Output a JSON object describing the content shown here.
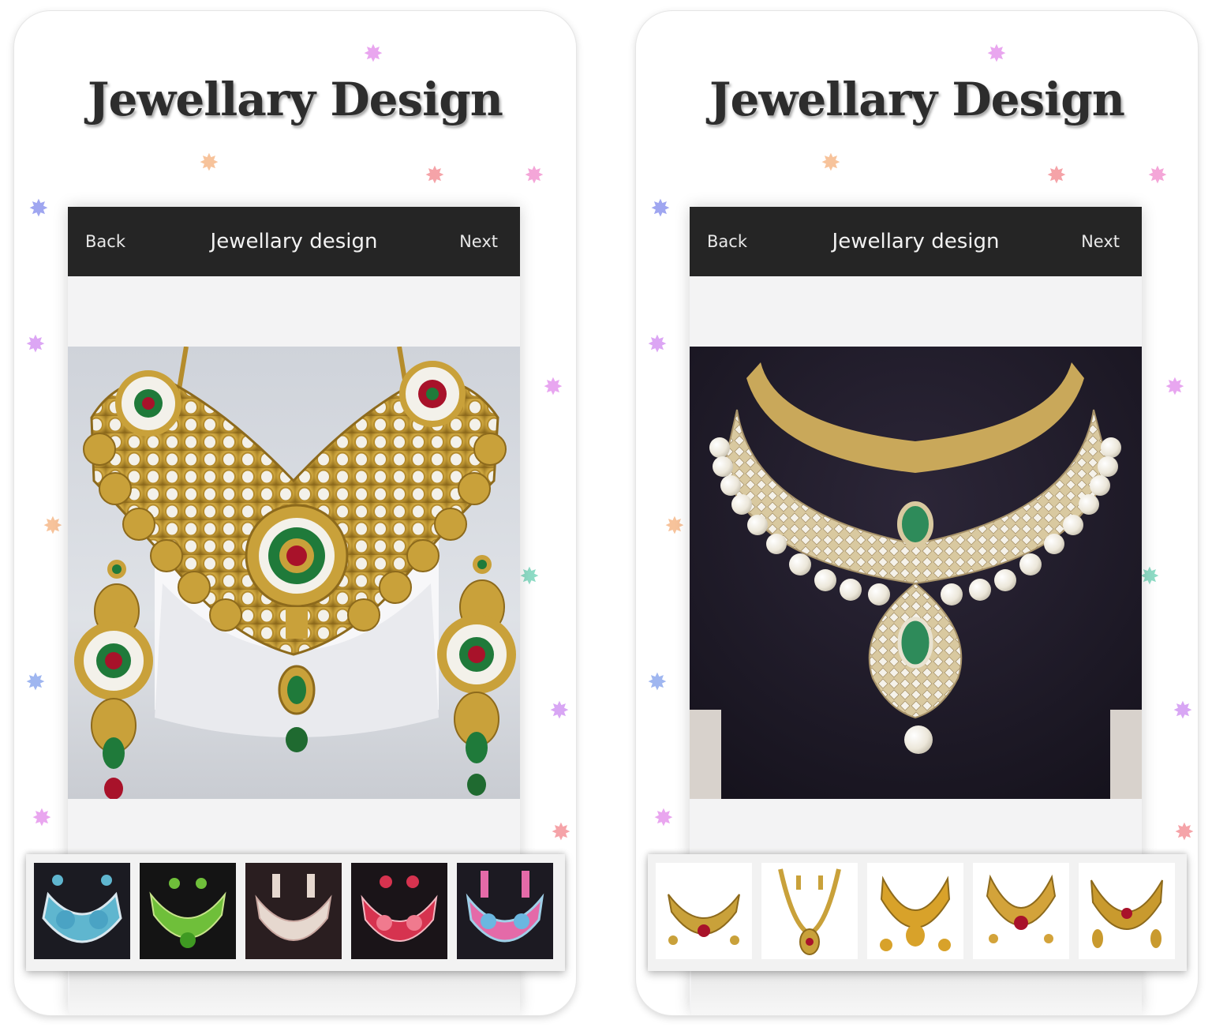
{
  "screens": [
    {
      "promo_title": "Jewellary Design",
      "app_bar": {
        "back_label": "Back",
        "title": "Jewellary design",
        "next_label": "Next"
      },
      "main_image": "Gold kundan necklace set with green and red stones on a white display stand",
      "thumbnails": [
        "Blue stone necklace set",
        "Green stone necklace set",
        "Pearl necklace set",
        "Red stone necklace set",
        "Pink and blue necklace set"
      ]
    },
    {
      "promo_title": "Jewellary Design",
      "app_bar": {
        "back_label": "Back",
        "title": "Jewellary design",
        "next_label": "Next"
      },
      "main_image": "Diamond choker necklace with pearls and emerald pendant on dark display",
      "thumbnails": [
        "Gold necklace set",
        "Gold long necklace with pendant",
        "Gold choker with earrings",
        "Gold necklace with red stone",
        "Gold antique necklace set"
      ]
    }
  ],
  "colors": {
    "app_bar": "#252525",
    "title_text": "#2d2d2d",
    "gold": "#c9a13a",
    "emerald": "#1f7a3a",
    "ruby": "#a8122a"
  }
}
